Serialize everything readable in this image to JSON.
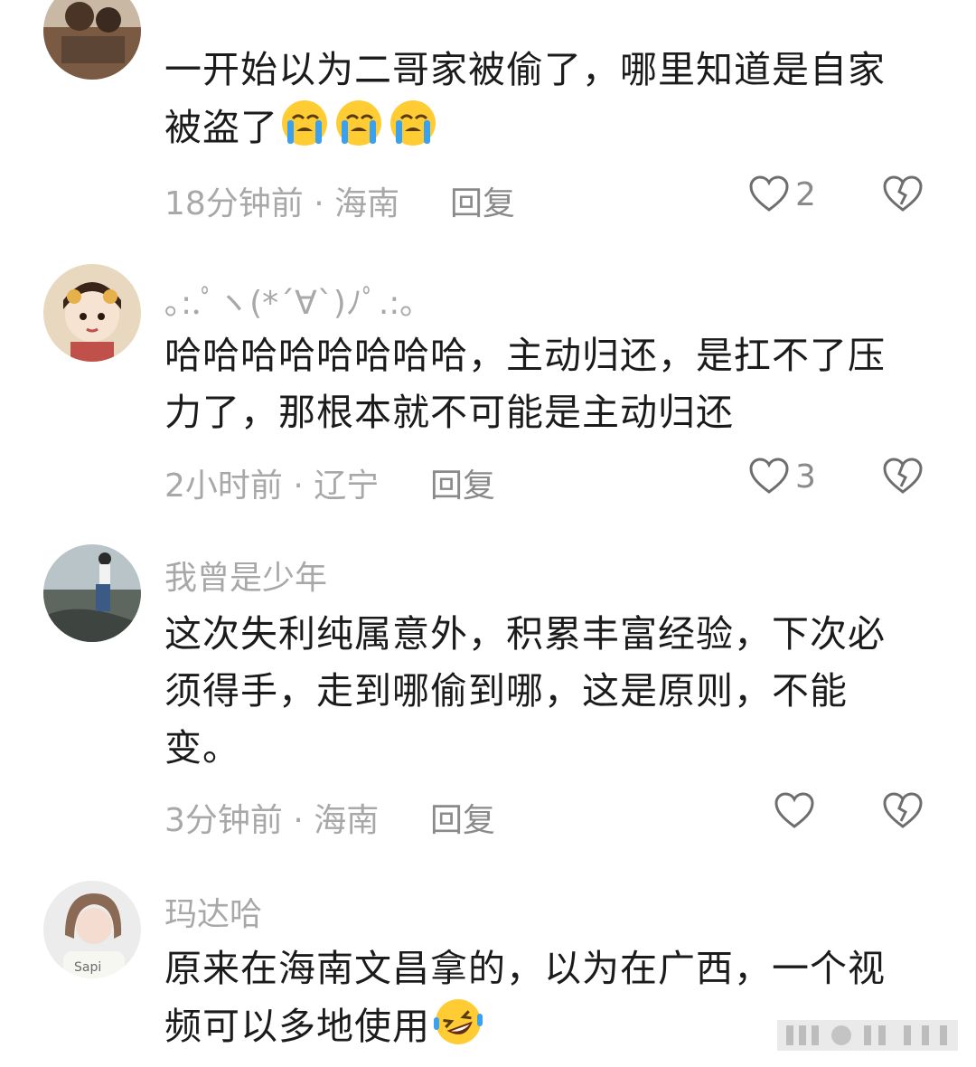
{
  "comments": [
    {
      "username": "",
      "text": "一开始以为二哥家被偷了，哪里知道是自家被盗了",
      "emoji": "😭😭😭",
      "time_location": "18分钟前 · 海南",
      "reply_label": "回复",
      "likes": "2"
    },
    {
      "username": "｡:.ﾟヽ(*´∀`)ﾉﾟ.:｡",
      "text": "哈哈哈哈哈哈哈哈，主动归还，是扛不了压力了，那根本就不可能是主动归还",
      "emoji": "",
      "time_location": "2小时前 · 辽宁",
      "reply_label": "回复",
      "likes": "3"
    },
    {
      "username": "我曾是少年",
      "text": "这次失利纯属意外，积累丰富经验，下次必须得手，走到哪偷到哪，这是原则，不能变。",
      "emoji": "",
      "time_location": "3分钟前 · 海南",
      "reply_label": "回复",
      "likes": ""
    },
    {
      "username": "玛达哈",
      "text": "原来在海南文昌拿的，以为在广西，一个视频可以多地使用",
      "emoji": "🤣",
      "time_location": "",
      "reply_label": "",
      "likes": ""
    }
  ],
  "colors": {
    "meta_text": "#a8a8a8",
    "body_text": "#1b1b1b",
    "icon_stroke": "#6e6e6e"
  }
}
